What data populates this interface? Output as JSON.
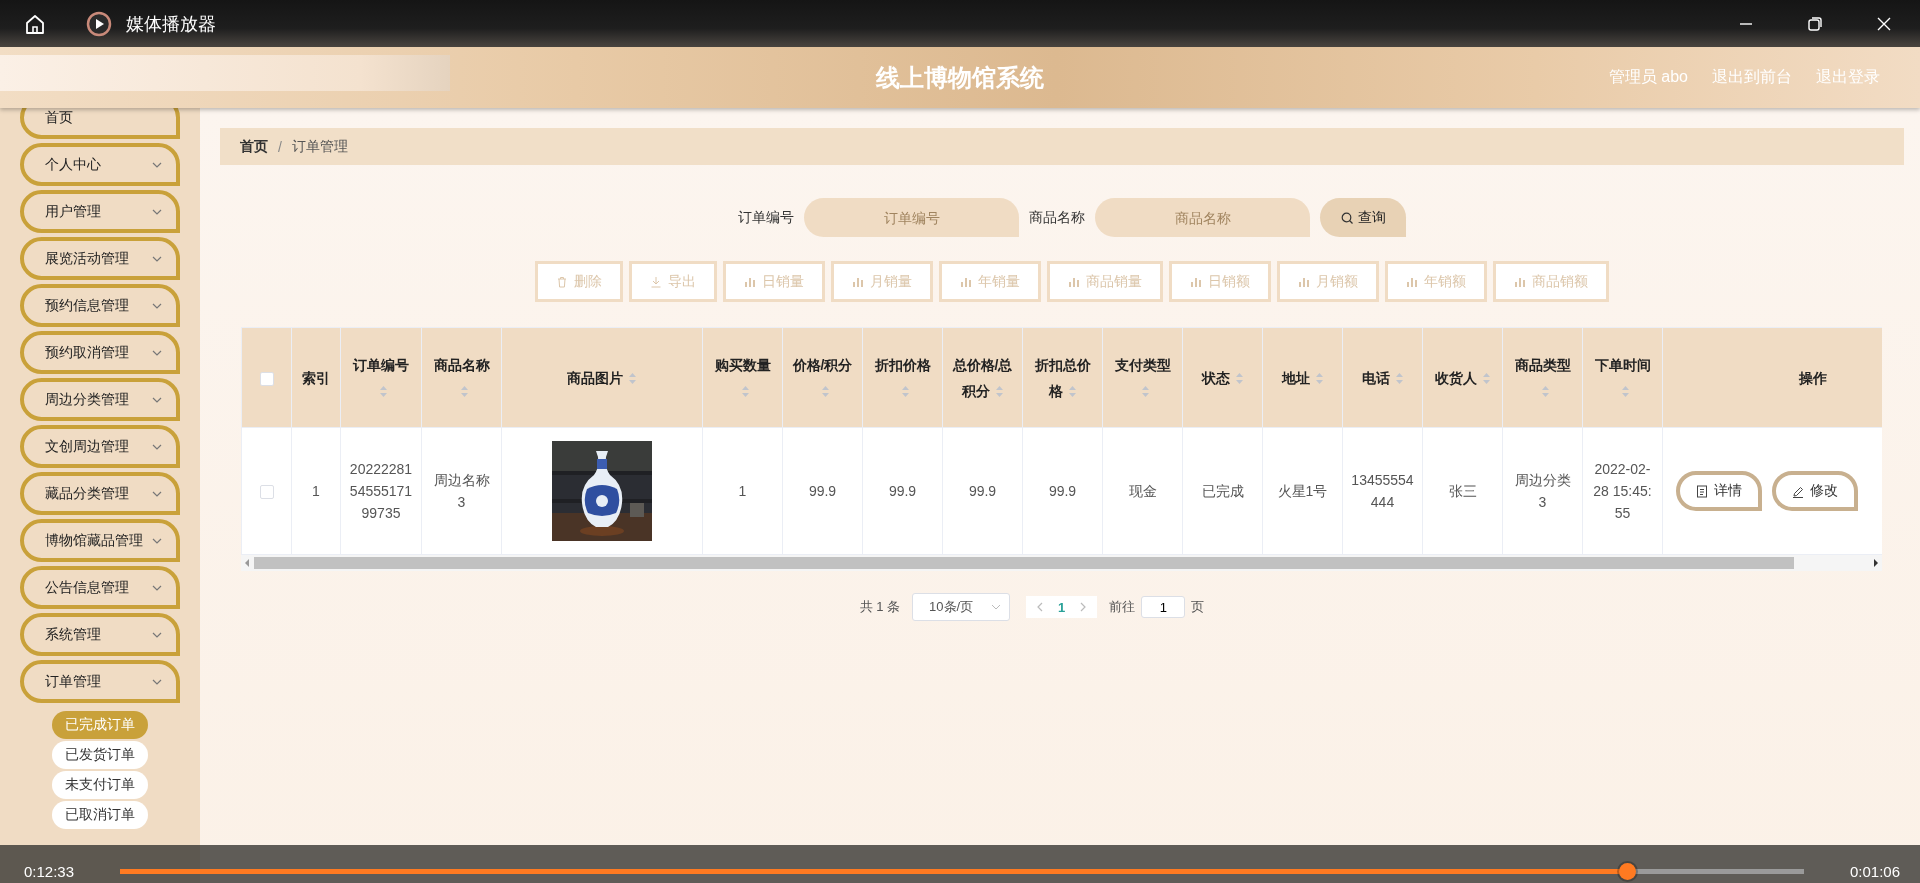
{
  "player": {
    "title": "媒体播放器",
    "time_elapsed": "0:12:33",
    "time_remaining": "0:01:06",
    "level": 0.895
  },
  "header": {
    "title": "线上博物馆系统",
    "user": "管理员 abo",
    "links": [
      "退出到前台",
      "退出登录"
    ]
  },
  "sidebar": {
    "items": [
      {
        "label": "首页",
        "expandable": false
      },
      {
        "label": "个人中心",
        "expandable": true
      },
      {
        "label": "用户管理",
        "expandable": true
      },
      {
        "label": "展览活动管理",
        "expandable": true
      },
      {
        "label": "预约信息管理",
        "expandable": true
      },
      {
        "label": "预约取消管理",
        "expandable": true
      },
      {
        "label": "周边分类管理",
        "expandable": true
      },
      {
        "label": "文创周边管理",
        "expandable": true
      },
      {
        "label": "藏品分类管理",
        "expandable": true
      },
      {
        "label": "博物馆藏品管理",
        "expandable": true
      },
      {
        "label": "公告信息管理",
        "expandable": true
      },
      {
        "label": "系统管理",
        "expandable": true
      },
      {
        "label": "订单管理",
        "expandable": true,
        "children": [
          {
            "label": "已完成订单",
            "selected": true
          },
          {
            "label": "已发货订单",
            "selected": false
          },
          {
            "label": "未支付订单",
            "selected": false
          },
          {
            "label": "已取消订单",
            "selected": false
          }
        ]
      }
    ]
  },
  "breadcrumb": {
    "items": [
      "首页",
      "订单管理"
    ],
    "separator": "/"
  },
  "search": {
    "fields": [
      {
        "label": "订单编号",
        "placeholder": "订单编号"
      },
      {
        "label": "商品名称",
        "placeholder": "商品名称"
      }
    ],
    "button": "查询"
  },
  "toolbar": [
    {
      "label": "删除",
      "kind": "delete"
    },
    {
      "label": "导出",
      "kind": "export"
    },
    {
      "label": "日销量",
      "kind": "chart"
    },
    {
      "label": "月销量",
      "kind": "chart"
    },
    {
      "label": "年销量",
      "kind": "chart"
    },
    {
      "label": "商品销量",
      "kind": "chart"
    },
    {
      "label": "日销额",
      "kind": "chart"
    },
    {
      "label": "月销额",
      "kind": "chart"
    },
    {
      "label": "年销额",
      "kind": "chart"
    },
    {
      "label": "商品销额",
      "kind": "chart"
    }
  ],
  "table": {
    "all_checked": false,
    "columns": [
      {
        "label": "索引",
        "sortable": false
      },
      {
        "label": "订单编号",
        "sortable": true
      },
      {
        "label": "商品名称",
        "sortable": true
      },
      {
        "label": "商品图片",
        "sortable": true
      },
      {
        "label": "购买数量",
        "sortable": true
      },
      {
        "label": "价格/积分",
        "sortable": true
      },
      {
        "label": "折扣价格",
        "sortable": true
      },
      {
        "label": "总价格/总积分",
        "sortable": true
      },
      {
        "label": "折扣总价格",
        "sortable": true
      },
      {
        "label": "支付类型",
        "sortable": true
      },
      {
        "label": "状态",
        "sortable": true
      },
      {
        "label": "地址",
        "sortable": true
      },
      {
        "label": "电话",
        "sortable": true
      },
      {
        "label": "收货人",
        "sortable": true
      },
      {
        "label": "商品类型",
        "sortable": true
      },
      {
        "label": "下单时间",
        "sortable": true
      },
      {
        "label": "操作",
        "sortable": false
      }
    ],
    "rows": [
      {
        "checked": false,
        "cells": [
          "1",
          "202222815455517199735",
          "周边名称3",
          {
            "kind": "picture"
          },
          "1",
          "99.9",
          "99.9",
          "99.9",
          "99.9",
          "现金",
          "已完成",
          "火星1号",
          "13455554444",
          "张三",
          "周边分类3",
          "2022-02-28 15:45:55",
          {
            "kind": "actions",
            "buttons": [
              {
                "label": "详情",
                "kind": "detail"
              },
              {
                "label": "修改",
                "kind": "edit"
              }
            ]
          }
        ]
      }
    ]
  },
  "pagination": {
    "total": "共 1 条",
    "page_size": "10条/页",
    "pages": [
      {
        "label": "1",
        "selected": true
      }
    ],
    "goto_label": "前往",
    "goto_value": "1",
    "goto_suffix": "页"
  }
}
